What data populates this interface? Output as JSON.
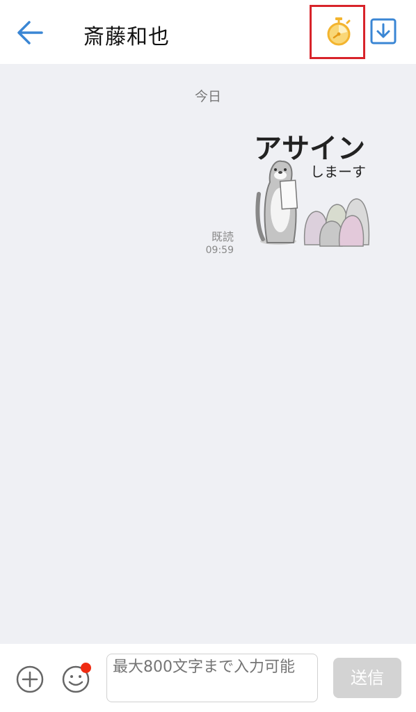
{
  "header": {
    "title": "斎藤和也",
    "back_icon": "arrow-left-icon",
    "timer_icon": "stopwatch-icon",
    "download_icon": "download-icon",
    "accent_color": "#3a86d4",
    "timer_color": "#f3b42e",
    "highlight_color": "#d8232a"
  },
  "chat": {
    "date_separator": "今日",
    "messages": [
      {
        "type": "sticker",
        "sticker_text_main": "アサイン",
        "sticker_text_sub": "しまーす",
        "read_status": "既読",
        "time": "09:59"
      }
    ]
  },
  "composer": {
    "add_icon": "plus-circle-icon",
    "emoji_icon": "smiley-icon",
    "placeholder": "最大800文字まで入力可能",
    "send_label": "送信"
  }
}
